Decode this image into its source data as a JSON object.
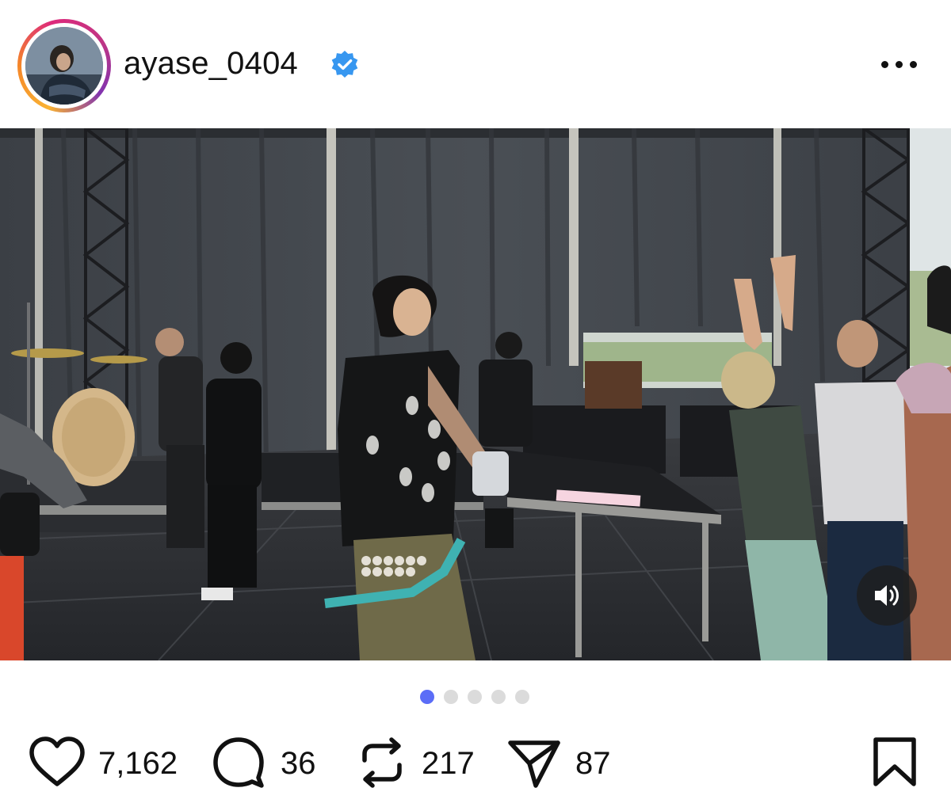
{
  "post": {
    "username": "ayase_0404",
    "verified": true,
    "avatar_icon": "profile-photo"
  },
  "media": {
    "type": "video",
    "sound_icon": "speaker-icon",
    "carousel_total": 5,
    "carousel_active": 1
  },
  "actions": {
    "likes": "7,162",
    "comments": "36",
    "reposts": "217",
    "shares": "87"
  },
  "colors": {
    "dot_active": "#5b6df7",
    "dot_inactive": "#dbdbdb",
    "verified_badge": "#3797f0"
  }
}
